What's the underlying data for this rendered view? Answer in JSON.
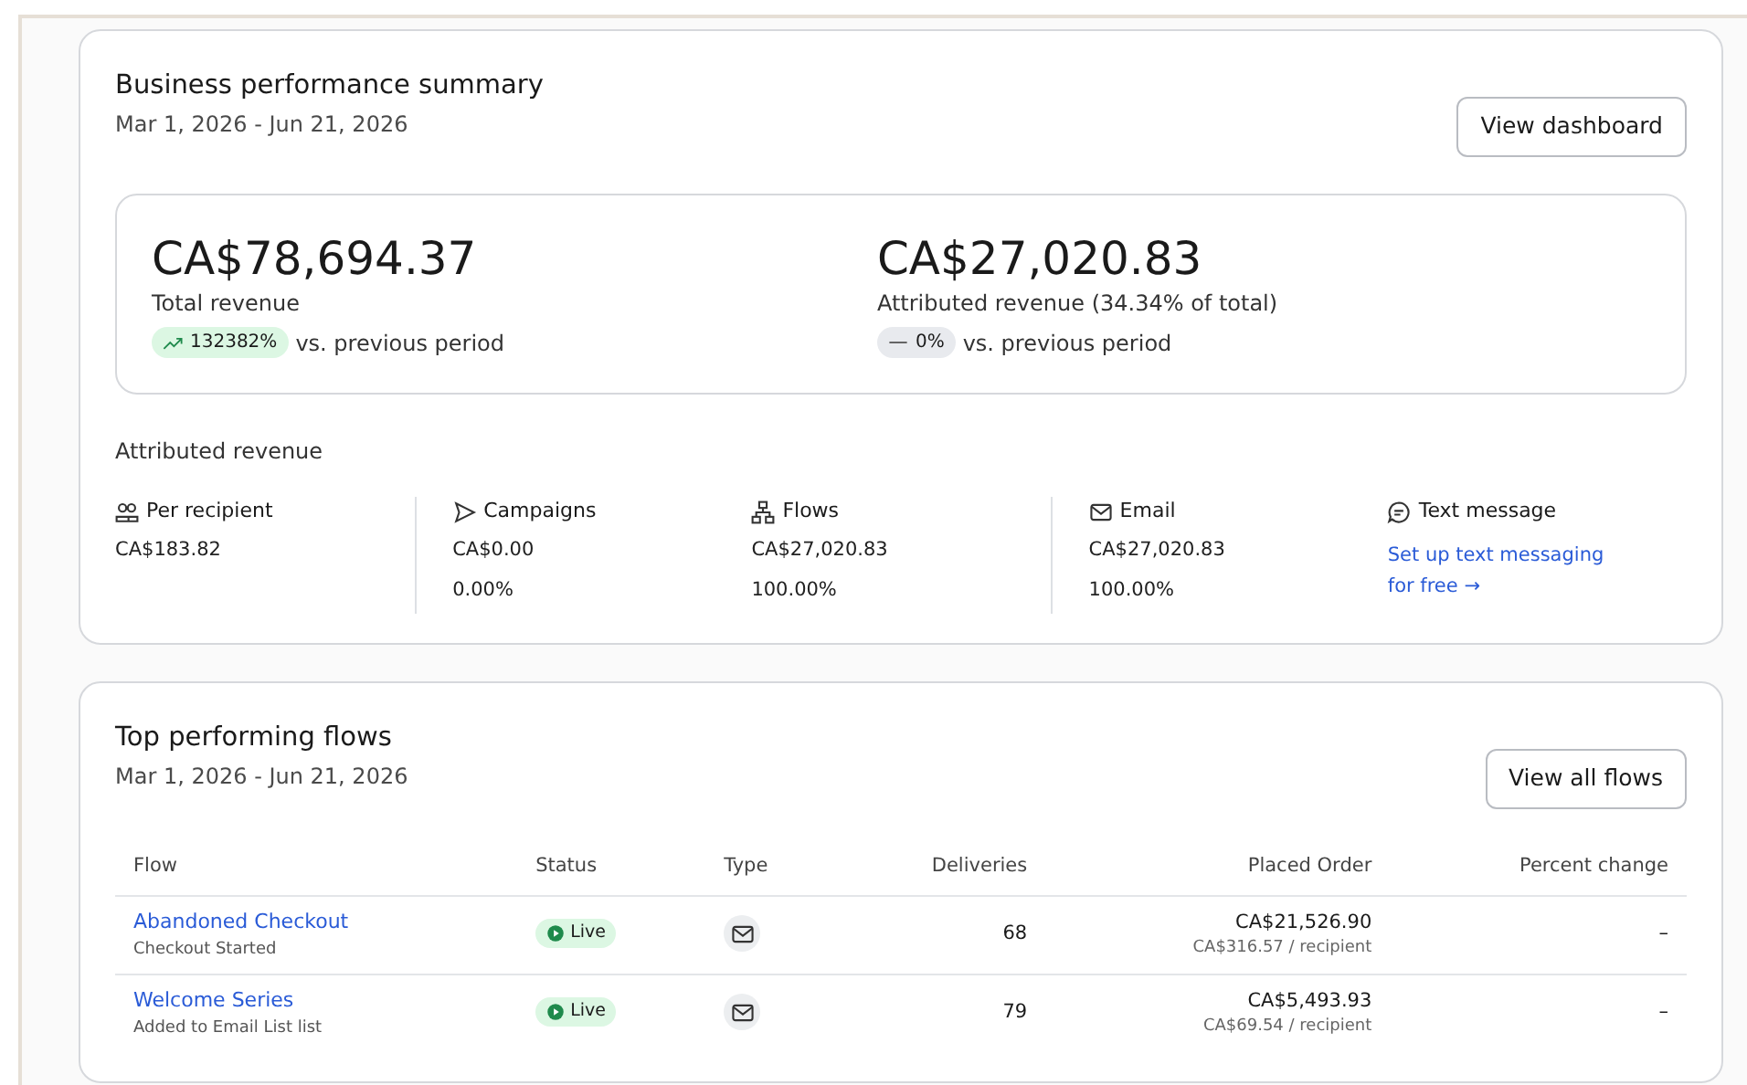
{
  "summary": {
    "title": "Business performance summary",
    "date_range": "Mar 1, 2026 - Jun 21, 2026",
    "button": "View dashboard",
    "totals": [
      {
        "amount": "CA$78,694.37",
        "label": "Total revenue",
        "trend": {
          "kind": "up",
          "value": "132382%"
        },
        "comparison": "vs. previous period"
      },
      {
        "amount": "CA$27,020.83",
        "label": "Attributed revenue (34.34% of total)",
        "trend": {
          "kind": "flat",
          "value": "0%"
        },
        "comparison": "vs. previous period"
      }
    ],
    "attributed": {
      "title": "Attributed revenue",
      "items": [
        {
          "kind": "metric",
          "label": "Per recipient",
          "value": "CA$183.82"
        },
        {
          "kind": "metric",
          "label": "Campaigns",
          "value": "CA$0.00",
          "share": "0.00%"
        },
        {
          "kind": "metric",
          "label": "Flows",
          "value": "CA$27,020.83",
          "share": "100.00%"
        },
        {
          "kind": "metric",
          "label": "Email",
          "value": "CA$27,020.83",
          "share": "100.00%"
        },
        {
          "kind": "link",
          "label": "Text message",
          "link": "Set up text messaging for free →"
        }
      ]
    }
  },
  "flows": {
    "title": "Top performing flows",
    "date_range": "Mar 1, 2026 - Jun 21, 2026",
    "button": "View all flows",
    "columns": [
      "Flow",
      "Status",
      "Type",
      "Deliveries",
      "Placed Order",
      "Percent change"
    ],
    "rows": [
      {
        "name": "Abandoned Checkout",
        "trigger": "Checkout Started",
        "status": {
          "kind": "live",
          "label": "Live"
        },
        "deliveries": "68",
        "placed_order": "CA$21,526.90",
        "per_recipient": "CA$316.57 / recipient",
        "percent_change": "–"
      },
      {
        "name": "Welcome Series",
        "trigger": "Added to Email List list",
        "status": {
          "kind": "live",
          "label": "Live"
        },
        "deliveries": "79",
        "placed_order": "CA$5,493.93",
        "per_recipient": "CA$69.54 / recipient",
        "percent_change": "–"
      }
    ]
  }
}
